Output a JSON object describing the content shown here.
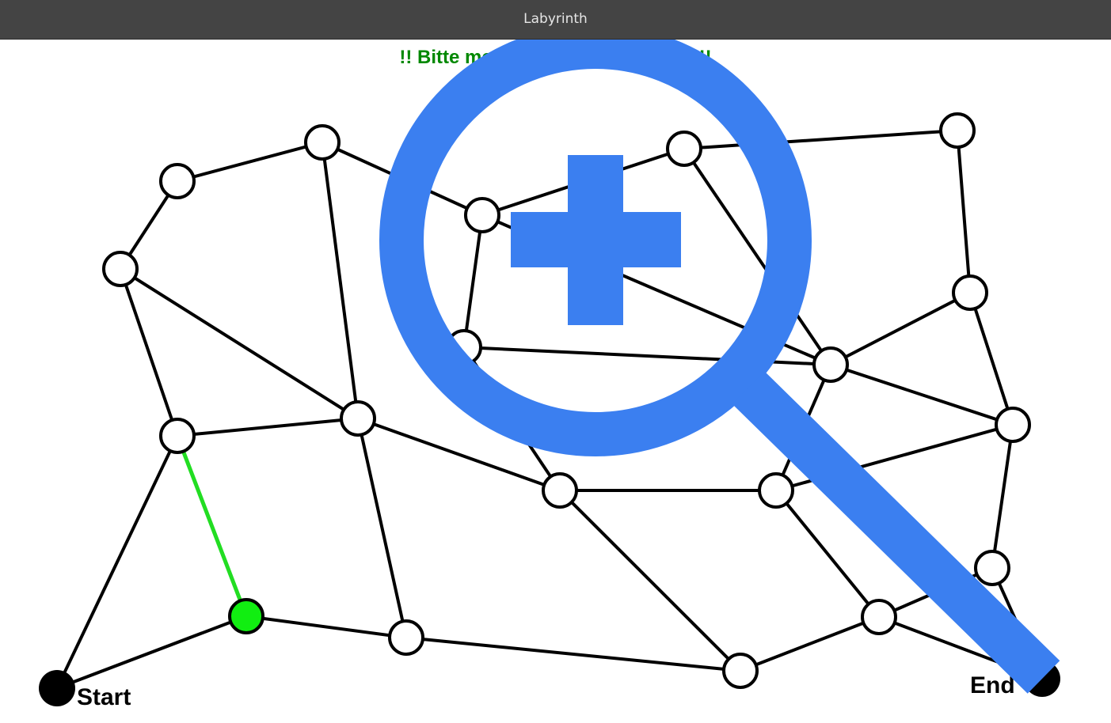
{
  "window": {
    "title": "Labyrinth"
  },
  "instruction": "!! Bitte merken Sie sich den Weg !!",
  "maze": {
    "start_label": "Start",
    "end_label": "End",
    "colors": {
      "edge": "#000000",
      "node_fill": "#ffffff",
      "node_stroke": "#000000",
      "active_node": "#11ee11",
      "active_edge": "#22dd22",
      "terminal": "#000000"
    }
  },
  "zoom_overlay": {
    "icon": "zoom-in-magnifier-icon",
    "color": "#3b7ff0"
  }
}
